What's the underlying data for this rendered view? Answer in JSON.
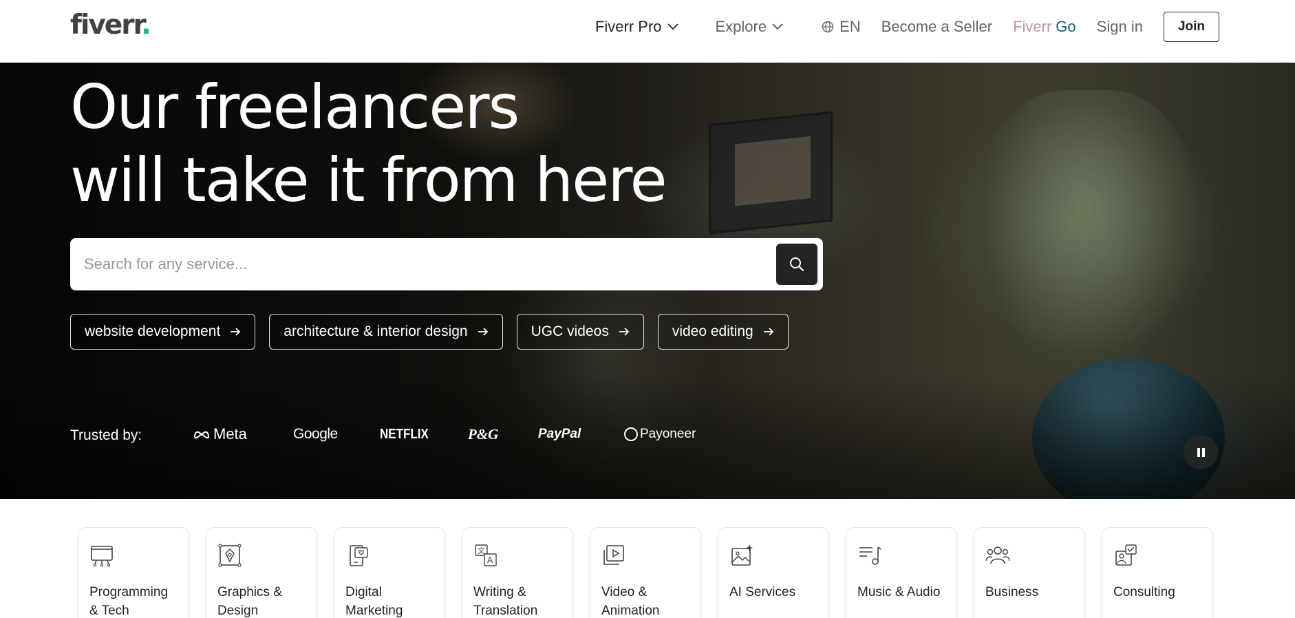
{
  "header": {
    "logo_text": "fiverr",
    "logo_dot": ".",
    "nav": {
      "fiverr_pro": "Fiverr Pro",
      "explore": "Explore",
      "language": "EN",
      "become_seller": "Become a Seller",
      "fiverr_go_1": "Fiverr",
      "fiverr_go_2": "Go",
      "sign_in": "Sign in",
      "join": "Join"
    }
  },
  "hero": {
    "title_line1": "Our freelancers",
    "title_line2": "will take it from here",
    "search": {
      "placeholder": "Search for any service..."
    },
    "chips": [
      "website development",
      "architecture & interior design",
      "UGC videos",
      "video editing"
    ],
    "trusted_label": "Trusted by:",
    "brands": [
      "Meta",
      "Google",
      "NETFLIX",
      "P&G",
      "PayPal",
      "Payoneer"
    ]
  },
  "categories": [
    {
      "line1": "Programming",
      "line2": "& Tech",
      "icon": "monitor-icon"
    },
    {
      "line1": "Graphics &",
      "line2": "Design",
      "icon": "design-icon"
    },
    {
      "line1": "Digital",
      "line2": "Marketing",
      "icon": "phone-heart-icon"
    },
    {
      "line1": "Writing &",
      "line2": "Translation",
      "icon": "translate-icon"
    },
    {
      "line1": "Video &",
      "line2": "Animation",
      "icon": "play-icon"
    },
    {
      "line1": "AI Services",
      "line2": "",
      "icon": "ai-image-icon"
    },
    {
      "line1": "Music & Audio",
      "line2": "",
      "icon": "music-icon"
    },
    {
      "line1": "Business",
      "line2": "",
      "icon": "people-icon"
    },
    {
      "line1": "Consulting",
      "line2": "",
      "icon": "consulting-icon"
    }
  ]
}
